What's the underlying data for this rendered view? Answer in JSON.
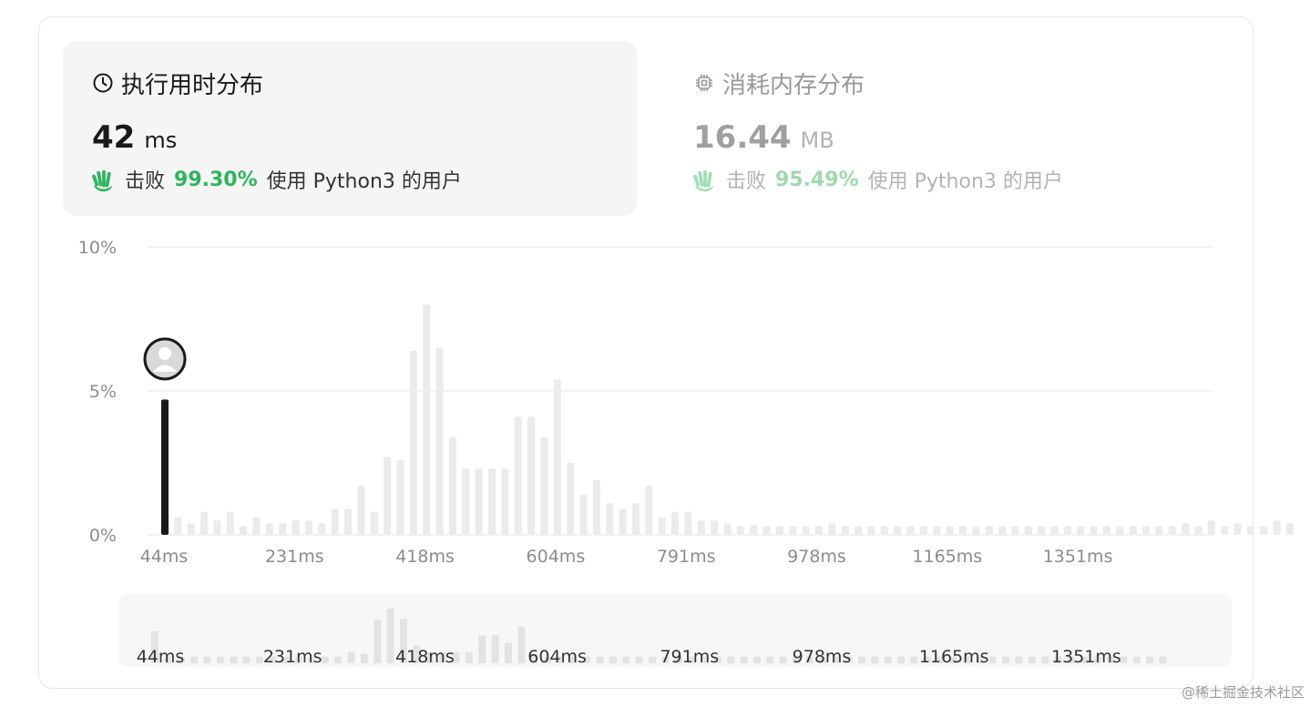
{
  "runtime_tab": {
    "title": "执行用时分布",
    "value": "42",
    "unit": "ms",
    "beats_prefix": "击败",
    "beats_pct": "99.30%",
    "beats_suffix": "使用 Python3 的用户",
    "icon": "clock-icon"
  },
  "memory_tab": {
    "title": "消耗内存分布",
    "value": "16.44",
    "unit": "MB",
    "beats_prefix": "击败",
    "beats_pct": "95.49%",
    "beats_suffix": "使用 Python3 的用户",
    "icon": "chip-icon"
  },
  "watermark": "@稀土掘金技术社区",
  "colors": {
    "highlight_bar": "#1a1a1a",
    "bar": "#ebebeb",
    "overview_bar": "#e3e3e3",
    "grid": "#e5e5e5",
    "axis_text": "#8c8c8c",
    "beats_green": "#2db55d"
  },
  "chart_data": {
    "type": "bar",
    "ylabel": "",
    "ylim": [
      0,
      10
    ],
    "y_ticks": [
      "0%",
      "5%",
      "10%"
    ],
    "x_ticks": [
      "44ms",
      "231ms",
      "418ms",
      "604ms",
      "791ms",
      "978ms",
      "1165ms",
      "1351ms"
    ],
    "x_start_ms": 44,
    "bin_ms": 9.35,
    "highlight_index": 0,
    "values": [
      4.7,
      0.6,
      0.4,
      0.8,
      0.5,
      0.8,
      0.3,
      0.6,
      0.4,
      0.4,
      0.5,
      0.5,
      0.4,
      0.9,
      0.9,
      1.7,
      0.8,
      2.7,
      2.6,
      6.4,
      8.0,
      6.5,
      3.4,
      2.3,
      2.3,
      2.3,
      2.3,
      4.1,
      4.1,
      3.4,
      5.4,
      2.5,
      1.4,
      1.9,
      1.1,
      0.9,
      1.1,
      1.7,
      0.6,
      0.8,
      0.8,
      0.5,
      0.5,
      0.4,
      0.3,
      0.35,
      0.3,
      0.3,
      0.3,
      0.3,
      0.3,
      0.4,
      0.3,
      0.3,
      0.3,
      0.3,
      0.3,
      0.3,
      0.3,
      0.3,
      0.3,
      0.3,
      0.3,
      0.3,
      0.3,
      0.3,
      0.3,
      0.3,
      0.3,
      0.3,
      0.3,
      0.3,
      0.3,
      0.3,
      0.3,
      0.3,
      0.3,
      0.3,
      0.4,
      0.3,
      0.5,
      0.3,
      0.4,
      0.3,
      0.3,
      0.5,
      0.4
    ]
  },
  "overview_data": {
    "x_ticks": [
      "44ms",
      "231ms",
      "418ms",
      "604ms",
      "791ms",
      "978ms",
      "1165ms",
      "1351ms"
    ],
    "values": [
      4.7,
      1.0,
      1.0,
      1.0,
      1.0,
      1.0,
      1.0,
      1.0,
      1.0,
      1.0,
      1.0,
      1.0,
      1.0,
      1.0,
      1.0,
      1.7,
      1.4,
      6.4,
      8.0,
      6.5,
      2.6,
      1.6,
      1.6,
      1.6,
      1.6,
      4.1,
      4.1,
      3.0,
      5.4,
      1.3,
      1.0,
      1.0,
      1.0,
      1.0,
      1.0,
      1.0,
      1.0,
      1.0,
      1.0,
      1.0,
      1.0,
      1.0,
      1.0,
      1.0,
      1.0,
      1.0,
      1.0,
      1.0,
      1.0,
      1.0,
      1.0,
      1.0,
      1.0,
      1.0,
      1.0,
      1.0,
      1.0,
      1.0,
      1.0,
      1.0,
      1.0,
      1.0,
      1.0,
      1.0,
      1.0,
      1.0,
      1.0,
      1.0,
      1.0,
      1.0,
      1.0,
      1.0,
      1.0,
      1.0,
      1.0,
      1.0,
      1.0,
      1.0
    ]
  }
}
